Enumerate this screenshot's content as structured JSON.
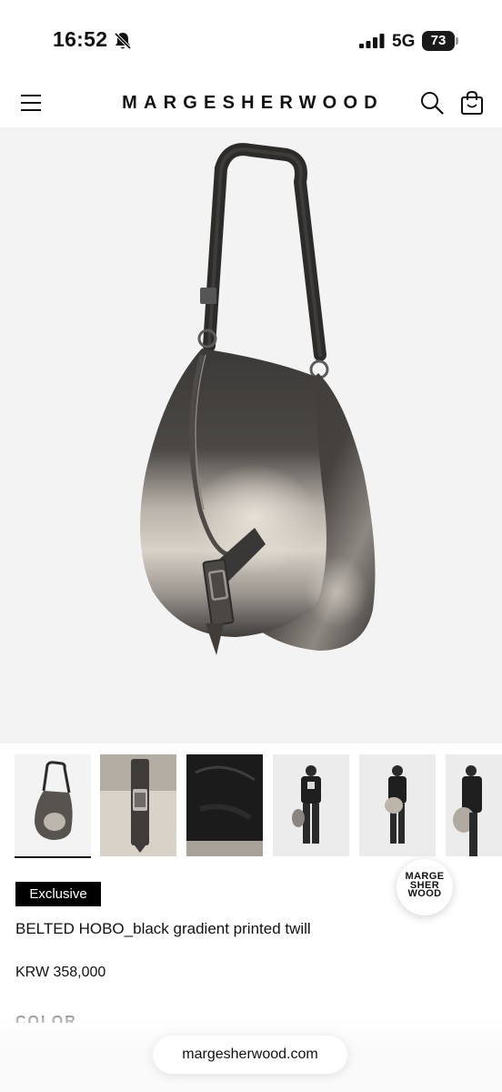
{
  "status_bar": {
    "time": "16:52",
    "network": "5G",
    "battery": "73",
    "icons": [
      "bell-slash-icon",
      "signal-icon"
    ]
  },
  "header": {
    "brand": "MARGESHERWOOD",
    "icons": [
      "menu-icon",
      "search-icon",
      "shopping-bag-icon"
    ]
  },
  "gallery": {
    "thumbnails": [
      {
        "name": "thumb-bag-front",
        "selected": true
      },
      {
        "name": "thumb-buckle-detail",
        "selected": false
      },
      {
        "name": "thumb-interior",
        "selected": false
      },
      {
        "name": "thumb-model-front",
        "selected": false
      },
      {
        "name": "thumb-model-side",
        "selected": false
      },
      {
        "name": "thumb-model-cropped",
        "selected": false
      }
    ]
  },
  "product": {
    "badge": "Exclusive",
    "title": "BELTED HOBO_black gradient printed twill",
    "price": "KRW 358,000",
    "color_label": "COLOR"
  },
  "floating_logo": {
    "line1": "MARGE",
    "line2": "SHER",
    "line3": "WOOD"
  },
  "browser": {
    "url": "margesherwood.com"
  },
  "colors": {
    "accent": "#000000",
    "hero_bg": "#f3f3f3"
  }
}
